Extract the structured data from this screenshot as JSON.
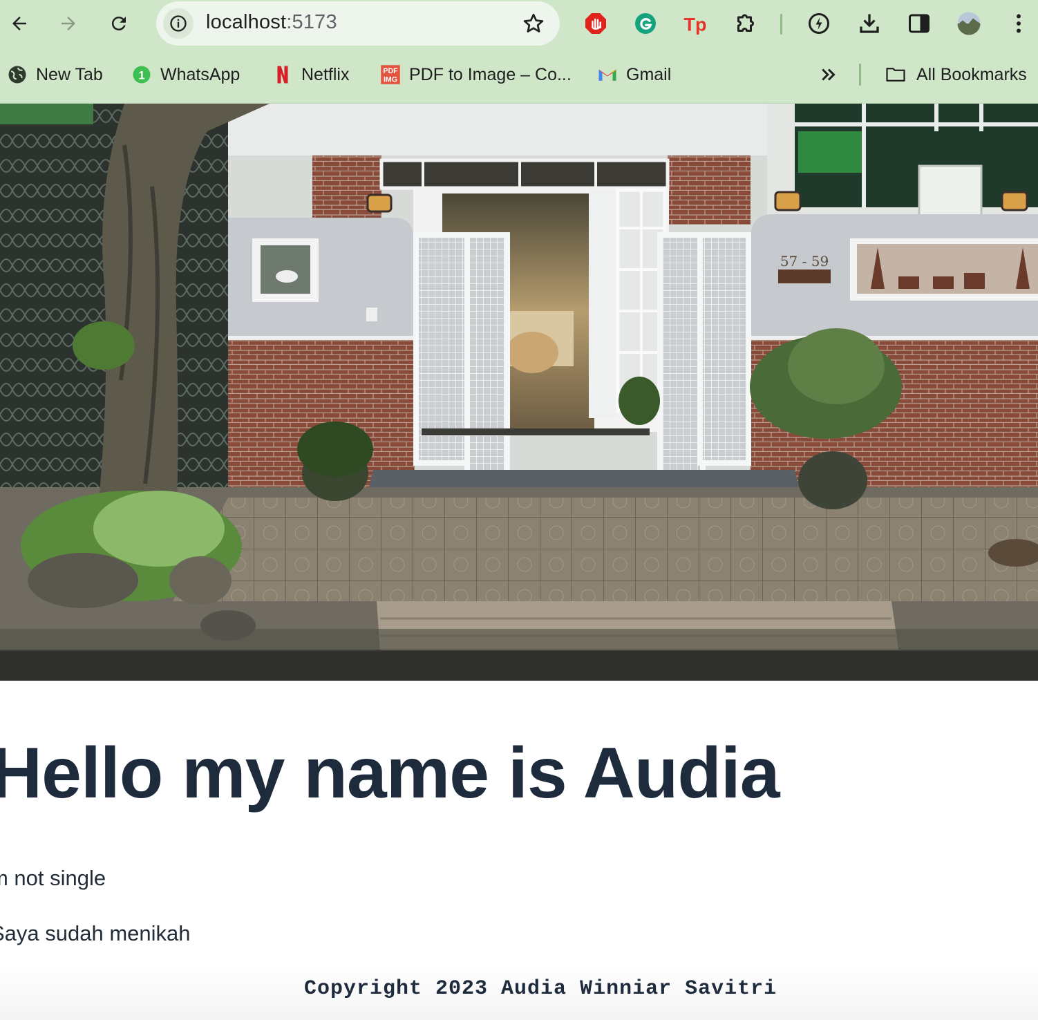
{
  "browser": {
    "url_host": "localhost",
    "url_port": ":5173",
    "bookmarks": [
      {
        "label": "New Tab",
        "icon": "globe-icon"
      },
      {
        "label": "WhatsApp",
        "icon": "whatsapp-icon",
        "badge": "1"
      },
      {
        "label": "Netflix",
        "icon": "netflix-icon"
      },
      {
        "label": "PDF to Image – Co...",
        "icon": "pdf-img-icon"
      },
      {
        "label": "Gmail",
        "icon": "gmail-icon"
      }
    ],
    "all_bookmarks_label": "All Bookmarks",
    "colors": {
      "chrome": "#cfe6c9",
      "omnibox": "#eef5ec"
    }
  },
  "hero": {
    "house_number": "57 - 59"
  },
  "page": {
    "headline": "Hello my name is Audia",
    "line1": "m not single",
    "line2": "Saya sudah menikah",
    "footer": "Copyright 2023 Audia Winniar Savitri",
    "text_color": "#1e2b3c"
  }
}
